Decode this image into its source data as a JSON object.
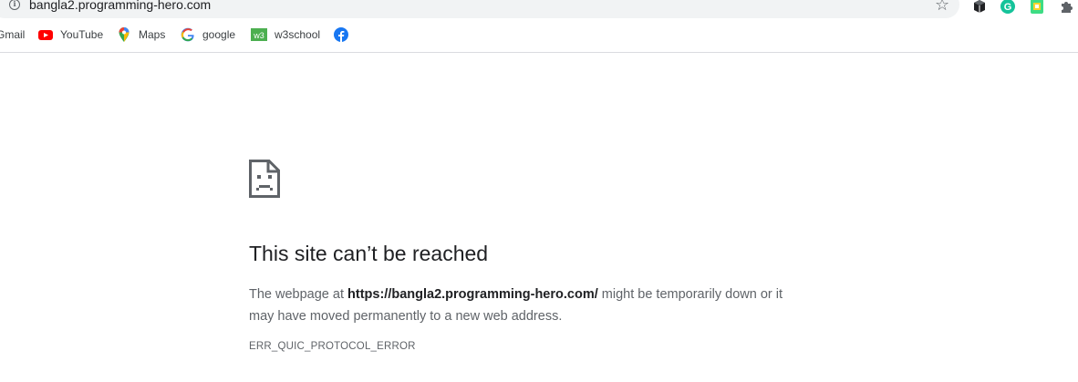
{
  "address_bar": {
    "url": "bangla2.programming-hero.com",
    "info_icon": "info-icon",
    "bookmark_icon": "star-icon"
  },
  "extensions": [
    {
      "name": "cube-extension-icon"
    },
    {
      "name": "grammarly-icon",
      "color": "#15c39a"
    },
    {
      "name": "green-extension-icon",
      "color": "#3ddc84"
    },
    {
      "name": "puzzle-extensions-icon"
    }
  ],
  "bookmarks": {
    "items": [
      {
        "label": "Gmail",
        "icon": "gmail-icon"
      },
      {
        "label": "YouTube",
        "icon": "youtube-icon",
        "color": "#ff0000"
      },
      {
        "label": "Maps",
        "icon": "maps-pin-icon"
      },
      {
        "label": "google",
        "icon": "google-g-icon"
      },
      {
        "label": "w3school",
        "icon": "w3school-icon",
        "color": "#4caf50"
      },
      {
        "label": "",
        "icon": "facebook-icon",
        "color": "#1877f2"
      }
    ]
  },
  "error_page": {
    "icon": "sad-page-icon",
    "headline": "This site can’t be reached",
    "desc_prefix": "The webpage at ",
    "desc_url": "https://bangla2.programming-hero.com/",
    "desc_suffix": " might be temporarily down or it may have moved permanently to a new web address.",
    "error_code": "ERR_QUIC_PROTOCOL_ERROR"
  }
}
